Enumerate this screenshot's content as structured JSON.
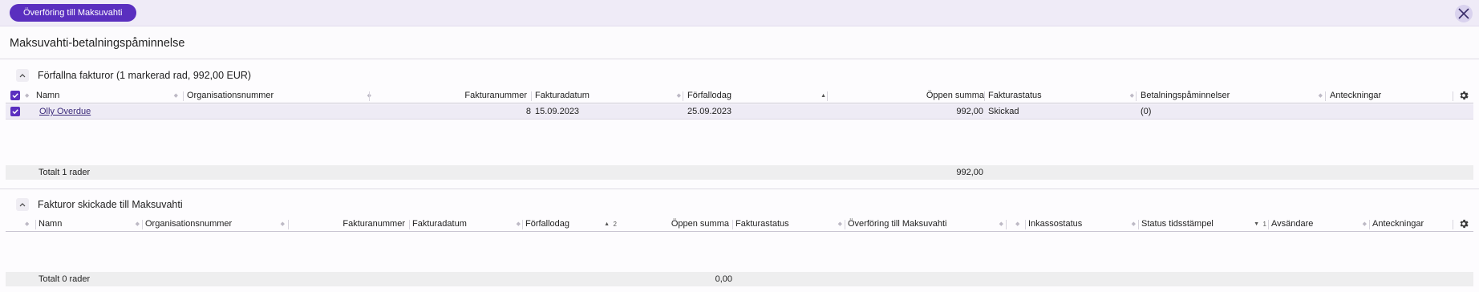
{
  "toolbar": {
    "transfer_button": "Överföring till Maksuvahti"
  },
  "page": {
    "title": "Maksuvahti-betalningspåminnelse"
  },
  "overdue": {
    "title": "Förfallna fakturor (1 markerad rad, 992,00 EUR)",
    "columns": {
      "namn": "Namn",
      "org": "Organisationsnummer",
      "fakturanummer": "Fakturanummer",
      "fakturadatum": "Fakturadatum",
      "forfallodag": "Förfallodag",
      "oppen": "Öppen summa",
      "status": "Fakturastatus",
      "paminnelser": "Betalningspåminnelser",
      "anteckningar": "Anteckningar"
    },
    "rows": [
      {
        "namn": "Olly Overdue",
        "org": "",
        "fakturanummer": "8",
        "fakturadatum": "15.09.2023",
        "forfallodag": "25.09.2023",
        "oppen": "992,00",
        "status": "Skickad",
        "paminnelser": "(0)",
        "anteckningar": "",
        "checked": true
      }
    ],
    "total_label": "Totalt 1 rader",
    "total_sum": "992,00"
  },
  "sent": {
    "title": "Fakturor skickade till Maksuvahti",
    "columns": {
      "namn": "Namn",
      "org": "Organisationsnummer",
      "fakturanummer": "Fakturanummer",
      "fakturadatum": "Fakturadatum",
      "forfallodag": "Förfallodag",
      "forfallodag_sort_rank": "2",
      "oppen": "Öppen summa",
      "status": "Fakturastatus",
      "overforing": "Överföring till Maksuvahti",
      "inkasso": "Inkassostatus",
      "tidsstampel": "Status tidsstämpel",
      "tidsstampel_sort_rank": "1",
      "avsandare": "Avsändare",
      "anteckningar": "Anteckningar"
    },
    "rows": [],
    "total_label": "Totalt 0 rader",
    "total_sum": "0,00"
  },
  "icons": {
    "close": "close-icon",
    "collapse": "chevron-up-icon",
    "settings": "gear-icon",
    "check": "check-icon"
  },
  "colors": {
    "accent": "#5a2fbf",
    "topbar": "#efebf7",
    "selected_row": "#eeebf5"
  }
}
